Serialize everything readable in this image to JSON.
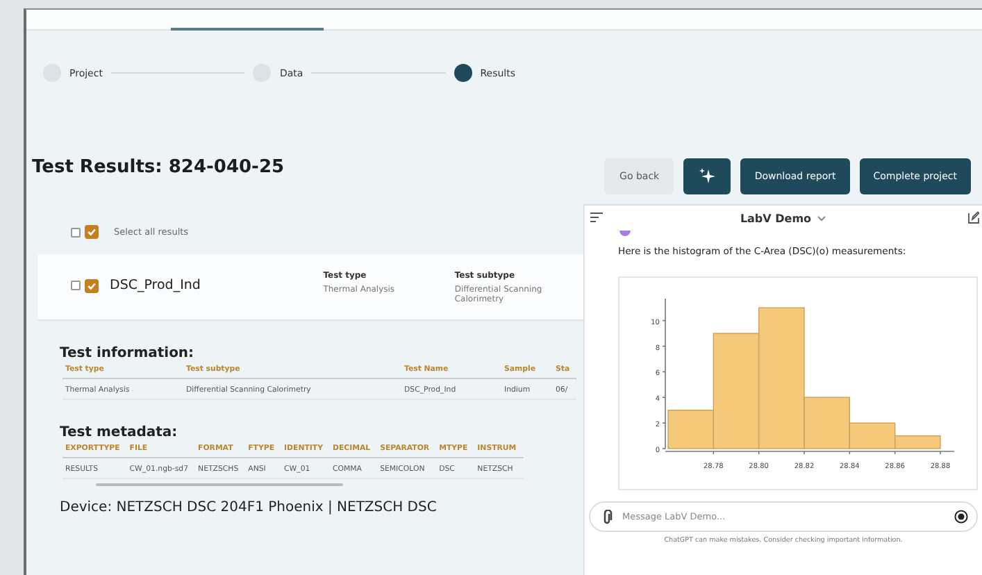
{
  "steps": [
    {
      "label": "Project",
      "selected": false
    },
    {
      "label": "Data",
      "selected": false
    },
    {
      "label": "Results",
      "selected": true
    }
  ],
  "title": "Test Results: 824-040-25",
  "actions": [
    {
      "kind": "secondary",
      "label": "Go back"
    },
    {
      "kind": "icon"
    },
    {
      "kind": "primary",
      "label": "Download report"
    },
    {
      "kind": "primary",
      "label": "Complete project"
    }
  ],
  "select_all": {
    "label": "Select all results",
    "checkboxes": [
      {
        "checked": false
      },
      {
        "checked": true
      }
    ]
  },
  "result_card": {
    "name": "DSC_Prod_Ind",
    "checkboxes": [
      {
        "checked": false
      },
      {
        "checked": true
      }
    ],
    "fields": [
      {
        "label": "Test type",
        "value": "Thermal Analysis"
      },
      {
        "label": "Test subtype",
        "value": "Differential Scanning Calorimetry"
      }
    ]
  },
  "test_information": {
    "heading": "Test information:",
    "columns": [
      "Test type",
      "Test subtype",
      "Test Name",
      "Sample",
      "Sta"
    ],
    "rows": [
      [
        "Thermal Analysis",
        "Differential Scanning Calorimetry",
        "DSC_Prod_Ind",
        "Indium",
        "06/"
      ]
    ]
  },
  "test_metadata": {
    "heading": "Test metadata:",
    "columns": [
      "EXPORTTYPE",
      "FILE",
      "FORMAT",
      "FTYPE",
      "IDENTITY",
      "DECIMAL",
      "SEPARATOR",
      "MTYPE",
      "INSTRUM"
    ],
    "rows": [
      [
        "RESULTS",
        "CW_01.ngb-sd7",
        "NETZSCHS",
        "ANSI",
        "CW_01",
        "COMMA",
        "SEMICOLON",
        "DSC",
        "NETZSCH"
      ]
    ]
  },
  "device_heading": "Device: NETZSCH DSC 204F1 Phoenix | NETZSCH DSC",
  "chat": {
    "title": "LabV Demo",
    "message": "Here is the histogram of the C-Area (DSC)(o) measurements:",
    "chart_data": {
      "type": "bar",
      "x": [
        28.77,
        28.79,
        28.81,
        28.83,
        28.85,
        28.87
      ],
      "values": [
        3,
        9,
        11,
        4,
        2,
        1
      ],
      "xlim": [
        28.76,
        28.88
      ],
      "ylim": [
        0,
        11.5
      ],
      "xticks": [
        {
          "value": 28.78,
          "label": "28.78"
        },
        {
          "value": 28.8,
          "label": "28.80"
        },
        {
          "value": 28.82,
          "label": "28.82"
        },
        {
          "value": 28.84,
          "label": "28.84"
        },
        {
          "value": 28.86,
          "label": "28.86"
        },
        {
          "value": 28.88,
          "label": "28.88"
        }
      ],
      "yticks": [
        0,
        2,
        4,
        6,
        8,
        10
      ]
    },
    "input_placeholder": "Message LabV Demo...",
    "disclaimer": "ChatGPT can make mistakes. Consider checking important information."
  }
}
